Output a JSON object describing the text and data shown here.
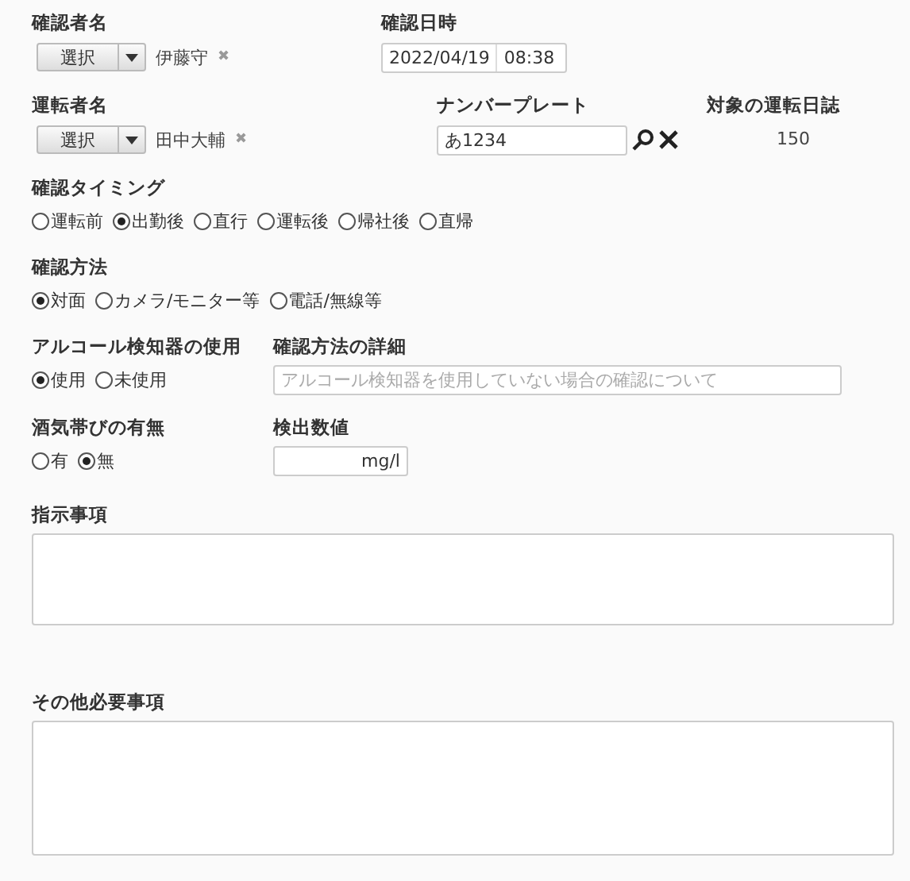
{
  "confirmer": {
    "label": "確認者名",
    "button": "選択",
    "name": "伊藤守",
    "clear": "✖"
  },
  "confirm_datetime": {
    "label": "確認日時",
    "date": "2022/04/19",
    "time": "08:38"
  },
  "driver": {
    "label": "運転者名",
    "button": "選択",
    "name": "田中大輔",
    "clear": "✖"
  },
  "plate": {
    "label": "ナンバープレート",
    "value": "あ1234"
  },
  "log": {
    "label": "対象の運転日誌",
    "value": "150"
  },
  "timing": {
    "label": "確認タイミング",
    "options": [
      {
        "label": "運転前",
        "selected": false
      },
      {
        "label": "出勤後",
        "selected": true
      },
      {
        "label": "直行",
        "selected": false
      },
      {
        "label": "運転後",
        "selected": false
      },
      {
        "label": "帰社後",
        "selected": false
      },
      {
        "label": "直帰",
        "selected": false
      }
    ]
  },
  "method": {
    "label": "確認方法",
    "options": [
      {
        "label": "対面",
        "selected": true
      },
      {
        "label": "カメラ/モニター等",
        "selected": false
      },
      {
        "label": "電話/無線等",
        "selected": false
      }
    ]
  },
  "detector": {
    "label": "アルコール検知器の使用",
    "options": [
      {
        "label": "使用",
        "selected": true
      },
      {
        "label": "未使用",
        "selected": false
      }
    ]
  },
  "method_detail": {
    "label": "確認方法の詳細",
    "placeholder": "アルコール検知器を使用していない場合の確認について"
  },
  "alcohol": {
    "label": "酒気帯びの有無",
    "options": [
      {
        "label": "有",
        "selected": false
      },
      {
        "label": "無",
        "selected": true
      }
    ]
  },
  "reading": {
    "label": "検出数値",
    "unit": "mg/l"
  },
  "instructions": {
    "label": "指示事項"
  },
  "other": {
    "label": "その他必要事項"
  }
}
